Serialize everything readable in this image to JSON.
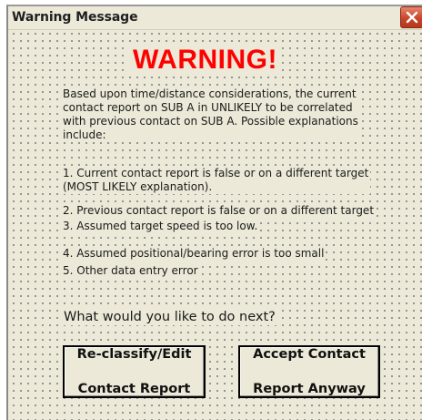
{
  "window": {
    "title": "Warning Message",
    "close_icon": "close-x-icon",
    "close_color": "#d5502f"
  },
  "heading": {
    "text": "WARNING!",
    "color": "#ff0000"
  },
  "message": {
    "intro_lines": [
      "Based upon time/distance considerations, the current",
      "contact report on SUB A in UNLIKELY to be correlated",
      "with previous contact on SUB A.  Possible explanations",
      "include:"
    ],
    "items": [
      {
        "lines": [
          "1.  Current contact report is false or on a different target",
          "(MOST LIKELY explanation)."
        ]
      },
      {
        "lines": [
          "2.  Previous contact report is false or on a different target"
        ]
      },
      {
        "lines": [
          "3.  Assumed target speed is too low."
        ]
      },
      {
        "lines": [
          "4.  Assumed positional/bearing error is too small"
        ]
      },
      {
        "lines": [
          "5.  Other data entry error"
        ]
      }
    ]
  },
  "prompt": {
    "question": "What would you like to do next?"
  },
  "buttons": {
    "reclassify": {
      "line1": "Re-classify/Edit",
      "line2": "Contact Report"
    },
    "accept": {
      "line1": "Accept Contact",
      "line2": "Report Anyway"
    }
  }
}
